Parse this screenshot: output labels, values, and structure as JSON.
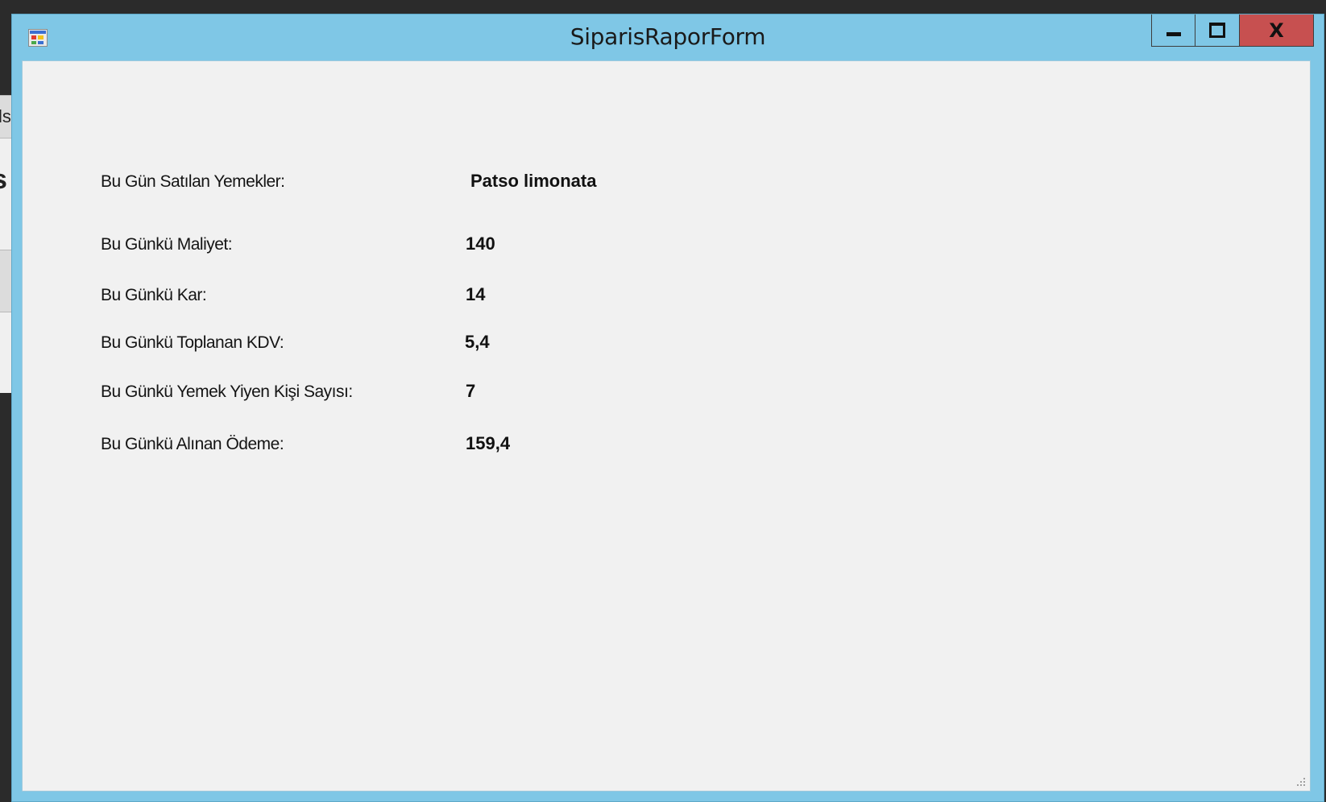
{
  "window": {
    "title": "SiparisRaporForm",
    "icon": "winforms-app-icon",
    "controls": {
      "minimize": "minimize-icon",
      "maximize": "maximize-icon",
      "close_label": "X"
    },
    "colors": {
      "frame": "#7fc7e6",
      "close": "#c75050",
      "client": "#f1f1f1"
    }
  },
  "background_window": {
    "fragments": [
      "ls",
      "s"
    ]
  },
  "report": {
    "rows": [
      {
        "label": "Bu Gün Satılan Yemekler:",
        "value": "Patso limonata"
      },
      {
        "label": "Bu Günkü Maliyet:",
        "value": "140"
      },
      {
        "label": "Bu Günkü Kar:",
        "value": "14"
      },
      {
        "label": "Bu Günkü Toplanan KDV:",
        "value": "5,4"
      },
      {
        "label": "Bu Günkü Yemek Yiyen Kişi Sayısı:",
        "value": "7"
      },
      {
        "label": "Bu Günkü Alınan Ödeme:",
        "value": "159,4"
      }
    ]
  }
}
